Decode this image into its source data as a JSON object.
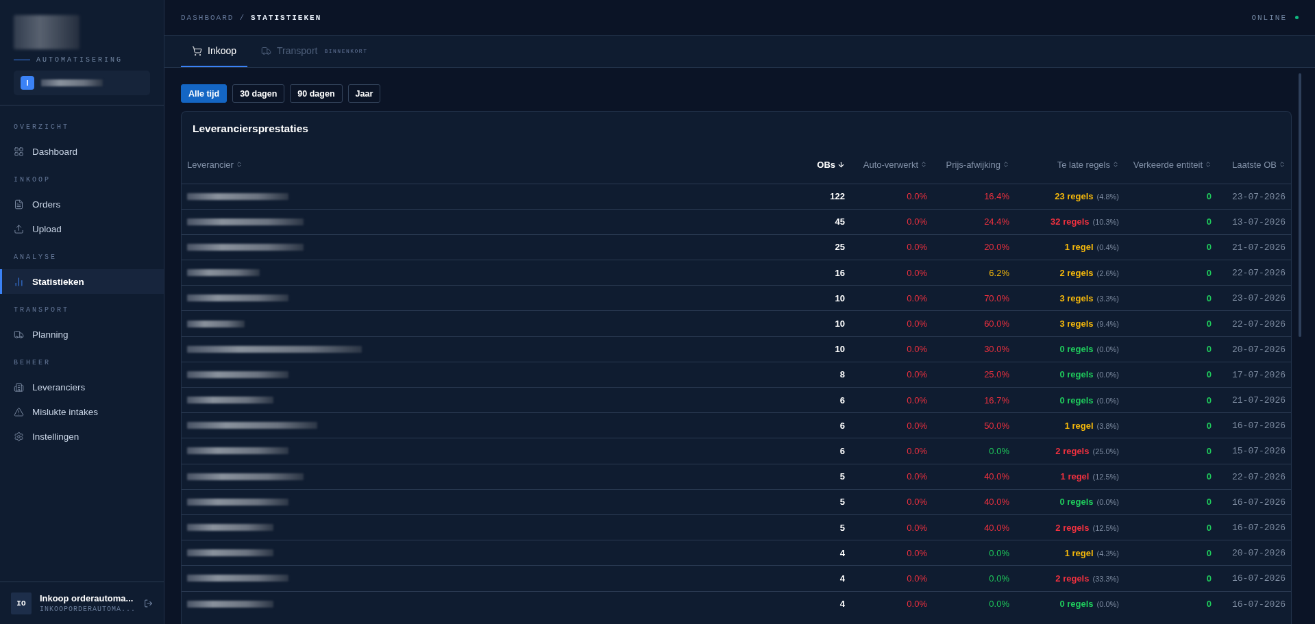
{
  "sidebar": {
    "subtitle": "AUTOMATISERING",
    "workspace": {
      "initial": "I"
    },
    "sections": [
      {
        "title": "OVERZICHT",
        "items": [
          {
            "label": "Dashboard",
            "selected": false
          }
        ]
      },
      {
        "title": "INKOOP",
        "items": [
          {
            "label": "Orders",
            "selected": false
          },
          {
            "label": "Upload",
            "selected": false
          }
        ]
      },
      {
        "title": "ANALYSE",
        "items": [
          {
            "label": "Statistieken",
            "selected": true
          }
        ]
      },
      {
        "title": "TRANSPORT",
        "items": [
          {
            "label": "Planning",
            "selected": false
          }
        ]
      },
      {
        "title": "BEHEER",
        "items": [
          {
            "label": "Leveranciers",
            "selected": false
          },
          {
            "label": "Mislukte intakes",
            "selected": false
          },
          {
            "label": "Instellingen",
            "selected": false
          }
        ]
      }
    ],
    "user": {
      "initials": "IO",
      "name": "Inkoop orderautoma...",
      "account": "INKOOPORDERAUTOMA..."
    }
  },
  "header": {
    "breadcrumb": [
      "DASHBOARD",
      "/",
      "STATISTIEKEN"
    ],
    "status": "ONLINE"
  },
  "tabs": [
    {
      "label": "Inkoop",
      "selected": true,
      "disabled": false
    },
    {
      "label": "Transport",
      "selected": false,
      "disabled": true,
      "badge": "BINNENKORT"
    }
  ],
  "filters": [
    {
      "label": "Alle tijd",
      "selected": true
    },
    {
      "label": "30 dagen",
      "selected": false
    },
    {
      "label": "90 dagen",
      "selected": false
    },
    {
      "label": "Jaar",
      "selected": false
    }
  ],
  "table": {
    "title": "Leveranciersprestaties",
    "columns": [
      {
        "label": "Leverancier",
        "sorted": false
      },
      {
        "label": "OBs",
        "sorted": true
      },
      {
        "label": "Auto-verwerkt",
        "sorted": false
      },
      {
        "label": "Prijs-afwijking",
        "sorted": false
      },
      {
        "label": "Te late regels",
        "sorted": false
      },
      {
        "label": "Verkeerde entiteit",
        "sorted": false
      },
      {
        "label": "Laatste OB",
        "sorted": false
      }
    ],
    "rows": [
      {
        "obs": "122",
        "auto": {
          "text": "0.0%",
          "color": "#f0313f"
        },
        "price": {
          "text": "16.4%",
          "color": "#f0313f"
        },
        "late": {
          "text": "23 regels",
          "share": "(4.8%)",
          "color": "#f5b80b"
        },
        "wrong": {
          "text": "0",
          "color": "#1fcb5c"
        },
        "last": "23-07-2026"
      },
      {
        "obs": "45",
        "auto": {
          "text": "0.0%",
          "color": "#f0313f"
        },
        "price": {
          "text": "24.4%",
          "color": "#f0313f"
        },
        "late": {
          "text": "32 regels",
          "share": "(10.3%)",
          "color": "#f0313f"
        },
        "wrong": {
          "text": "0",
          "color": "#1fcb5c"
        },
        "last": "13-07-2026"
      },
      {
        "obs": "25",
        "auto": {
          "text": "0.0%",
          "color": "#f0313f"
        },
        "price": {
          "text": "20.0%",
          "color": "#f0313f"
        },
        "late": {
          "text": "1 regel",
          "share": "(0.4%)",
          "color": "#f5b80b"
        },
        "wrong": {
          "text": "0",
          "color": "#1fcb5c"
        },
        "last": "21-07-2026"
      },
      {
        "obs": "16",
        "auto": {
          "text": "0.0%",
          "color": "#f0313f"
        },
        "price": {
          "text": "6.2%",
          "color": "#f5b80b"
        },
        "late": {
          "text": "2 regels",
          "share": "(2.6%)",
          "color": "#f5b80b"
        },
        "wrong": {
          "text": "0",
          "color": "#1fcb5c"
        },
        "last": "22-07-2026"
      },
      {
        "obs": "10",
        "auto": {
          "text": "0.0%",
          "color": "#f0313f"
        },
        "price": {
          "text": "70.0%",
          "color": "#f0313f"
        },
        "late": {
          "text": "3 regels",
          "share": "(3.3%)",
          "color": "#f5b80b"
        },
        "wrong": {
          "text": "0",
          "color": "#1fcb5c"
        },
        "last": "23-07-2026"
      },
      {
        "obs": "10",
        "auto": {
          "text": "0.0%",
          "color": "#f0313f"
        },
        "price": {
          "text": "60.0%",
          "color": "#f0313f"
        },
        "late": {
          "text": "3 regels",
          "share": "(9.4%)",
          "color": "#f5b80b"
        },
        "wrong": {
          "text": "0",
          "color": "#1fcb5c"
        },
        "last": "22-07-2026"
      },
      {
        "obs": "10",
        "auto": {
          "text": "0.0%",
          "color": "#f0313f"
        },
        "price": {
          "text": "30.0%",
          "color": "#f0313f"
        },
        "late": {
          "text": "0 regels",
          "share": "(0.0%)",
          "color": "#1fcb5c"
        },
        "wrong": {
          "text": "0",
          "color": "#1fcb5c"
        },
        "last": "20-07-2026"
      },
      {
        "obs": "8",
        "auto": {
          "text": "0.0%",
          "color": "#f0313f"
        },
        "price": {
          "text": "25.0%",
          "color": "#f0313f"
        },
        "late": {
          "text": "0 regels",
          "share": "(0.0%)",
          "color": "#1fcb5c"
        },
        "wrong": {
          "text": "0",
          "color": "#1fcb5c"
        },
        "last": "17-07-2026"
      },
      {
        "obs": "6",
        "auto": {
          "text": "0.0%",
          "color": "#f0313f"
        },
        "price": {
          "text": "16.7%",
          "color": "#f0313f"
        },
        "late": {
          "text": "0 regels",
          "share": "(0.0%)",
          "color": "#1fcb5c"
        },
        "wrong": {
          "text": "0",
          "color": "#1fcb5c"
        },
        "last": "21-07-2026"
      },
      {
        "obs": "6",
        "auto": {
          "text": "0.0%",
          "color": "#f0313f"
        },
        "price": {
          "text": "50.0%",
          "color": "#f0313f"
        },
        "late": {
          "text": "1 regel",
          "share": "(3.8%)",
          "color": "#f5b80b"
        },
        "wrong": {
          "text": "0",
          "color": "#1fcb5c"
        },
        "last": "16-07-2026"
      },
      {
        "obs": "6",
        "auto": {
          "text": "0.0%",
          "color": "#f0313f"
        },
        "price": {
          "text": "0.0%",
          "color": "#1fcb5c"
        },
        "late": {
          "text": "2 regels",
          "share": "(25.0%)",
          "color": "#f0313f"
        },
        "wrong": {
          "text": "0",
          "color": "#1fcb5c"
        },
        "last": "15-07-2026"
      },
      {
        "obs": "5",
        "auto": {
          "text": "0.0%",
          "color": "#f0313f"
        },
        "price": {
          "text": "40.0%",
          "color": "#f0313f"
        },
        "late": {
          "text": "1 regel",
          "share": "(12.5%)",
          "color": "#f0313f"
        },
        "wrong": {
          "text": "0",
          "color": "#1fcb5c"
        },
        "last": "22-07-2026"
      },
      {
        "obs": "5",
        "auto": {
          "text": "0.0%",
          "color": "#f0313f"
        },
        "price": {
          "text": "40.0%",
          "color": "#f0313f"
        },
        "late": {
          "text": "0 regels",
          "share": "(0.0%)",
          "color": "#1fcb5c"
        },
        "wrong": {
          "text": "0",
          "color": "#1fcb5c"
        },
        "last": "16-07-2026"
      },
      {
        "obs": "5",
        "auto": {
          "text": "0.0%",
          "color": "#f0313f"
        },
        "price": {
          "text": "40.0%",
          "color": "#f0313f"
        },
        "late": {
          "text": "2 regels",
          "share": "(12.5%)",
          "color": "#f0313f"
        },
        "wrong": {
          "text": "0",
          "color": "#1fcb5c"
        },
        "last": "16-07-2026"
      },
      {
        "obs": "4",
        "auto": {
          "text": "0.0%",
          "color": "#f0313f"
        },
        "price": {
          "text": "0.0%",
          "color": "#1fcb5c"
        },
        "late": {
          "text": "1 regel",
          "share": "(4.3%)",
          "color": "#f5b80b"
        },
        "wrong": {
          "text": "0",
          "color": "#1fcb5c"
        },
        "last": "20-07-2026"
      },
      {
        "obs": "4",
        "auto": {
          "text": "0.0%",
          "color": "#f0313f"
        },
        "price": {
          "text": "0.0%",
          "color": "#1fcb5c"
        },
        "late": {
          "text": "2 regels",
          "share": "(33.3%)",
          "color": "#f0313f"
        },
        "wrong": {
          "text": "0",
          "color": "#1fcb5c"
        },
        "last": "16-07-2026"
      },
      {
        "obs": "4",
        "auto": {
          "text": "0.0%",
          "color": "#f0313f"
        },
        "price": {
          "text": "0.0%",
          "color": "#1fcb5c"
        },
        "late": {
          "text": "0 regels",
          "share": "(0.0%)",
          "color": "#1fcb5c"
        },
        "wrong": {
          "text": "0",
          "color": "#1fcb5c"
        },
        "last": "16-07-2026"
      }
    ]
  }
}
